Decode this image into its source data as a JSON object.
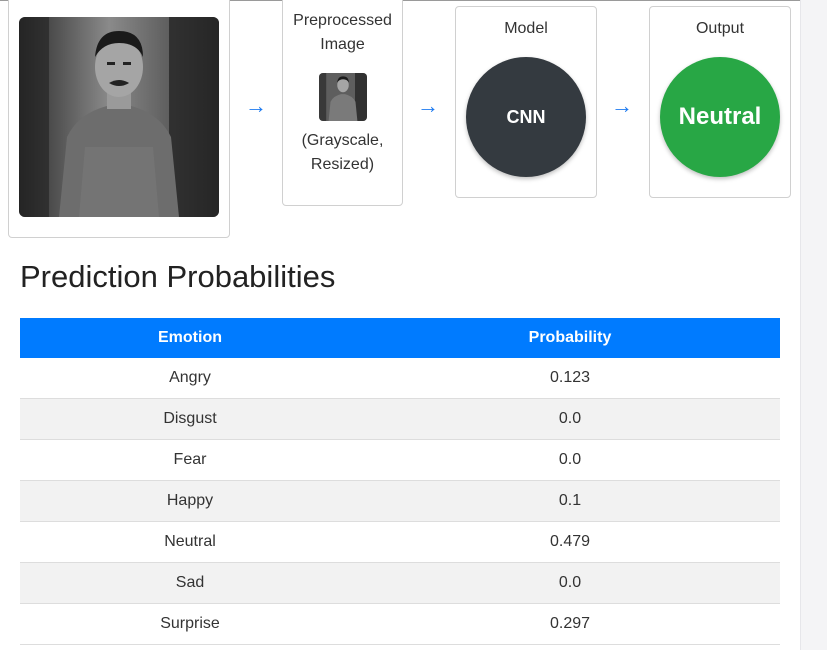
{
  "pipeline": {
    "preprocessed": {
      "title": "Preprocessed Image",
      "caption": "(Grayscale, Resized)"
    },
    "model": {
      "title": "Model",
      "label": "CNN"
    },
    "output": {
      "title": "Output",
      "label": "Neutral"
    },
    "arrow_glyph": "→"
  },
  "predictions": {
    "title": "Prediction Probabilities",
    "headers": [
      "Emotion",
      "Probability"
    ],
    "rows": [
      {
        "emotion": "Angry",
        "probability": "0.123"
      },
      {
        "emotion": "Disgust",
        "probability": "0.0"
      },
      {
        "emotion": "Fear",
        "probability": "0.0"
      },
      {
        "emotion": "Happy",
        "probability": "0.1"
      },
      {
        "emotion": "Neutral",
        "probability": "0.479"
      },
      {
        "emotion": "Sad",
        "probability": "0.0"
      },
      {
        "emotion": "Surprise",
        "probability": "0.297"
      }
    ]
  },
  "colors": {
    "header_blue": "#007bff",
    "model_dark": "#343a40",
    "output_green": "#28a745",
    "arrow_blue": "#1e7bf0"
  }
}
